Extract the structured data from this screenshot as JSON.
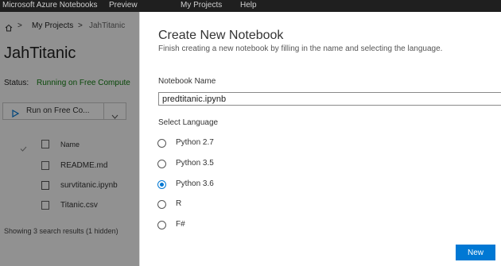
{
  "topbar": {
    "app_title": "Microsoft Azure Notebooks",
    "preview": "Preview",
    "nav_my_projects": "My Projects",
    "nav_help": "Help"
  },
  "breadcrumb": {
    "home_icon": "home-icon",
    "separator": ">",
    "my_projects": "My Projects",
    "current": "JahTitanic"
  },
  "project": {
    "title": "JahTitanic",
    "status_label": "Status:",
    "status_value": "Running on Free Compute",
    "run_button": "Run on Free Co...",
    "run_icon": "play-icon",
    "dropdown_icon": "chevron-down-icon"
  },
  "files": {
    "header_name": "Name",
    "items": [
      {
        "name": "README.md",
        "icon": "file-icon"
      },
      {
        "name": "survtitanic.ipynb",
        "icon": "notebook-icon"
      },
      {
        "name": "Titanic.csv",
        "icon": "file-icon"
      }
    ],
    "results_text": "Showing 3 search results (1 hidden)"
  },
  "dialog": {
    "title": "Create New Notebook",
    "subtitle": "Finish creating a new notebook by filling in the name and selecting the language.",
    "name_label": "Notebook Name",
    "name_value": "predtitanic.ipynb",
    "language_label": "Select Language",
    "languages": [
      {
        "label": "Python 2.7",
        "selected": false
      },
      {
        "label": "Python 3.5",
        "selected": false
      },
      {
        "label": "Python 3.6",
        "selected": true
      },
      {
        "label": "R",
        "selected": false
      },
      {
        "label": "F#",
        "selected": false
      }
    ],
    "new_button": "New"
  },
  "colors": {
    "accent": "#0078d4",
    "status_green": "#107c10",
    "topbar_bg": "#1f1f1f"
  }
}
